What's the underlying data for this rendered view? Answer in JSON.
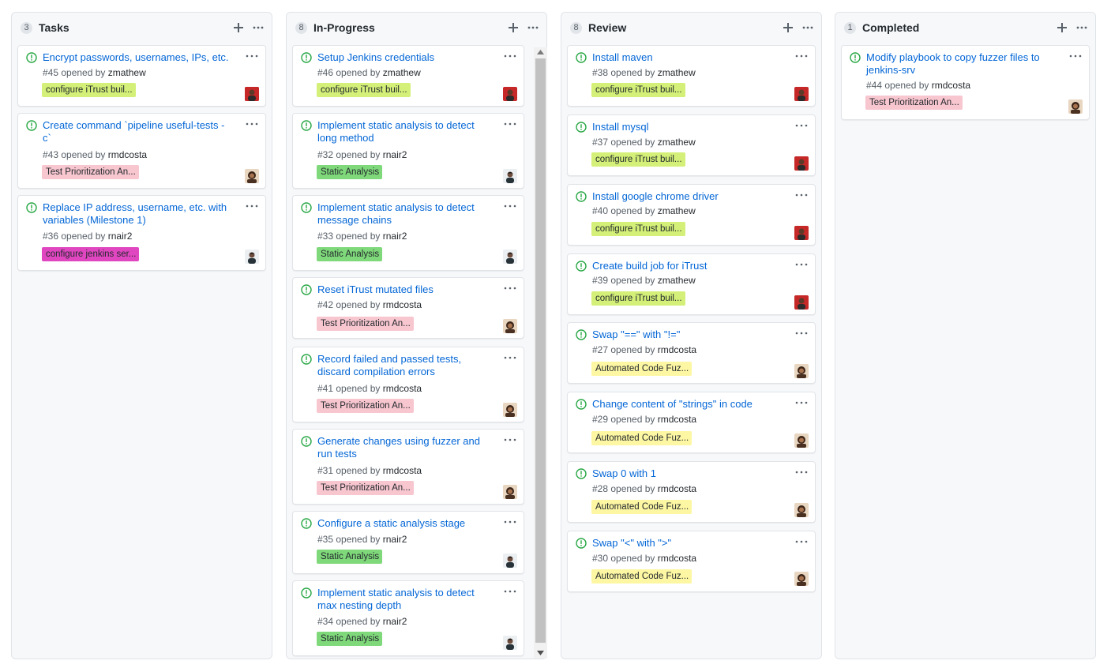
{
  "colors": {
    "configure_itrust": "#d4f078",
    "test_prioritization": "#f7c6cf",
    "static_analysis": "#7fd97a",
    "configure_jenkins": "#e046c0",
    "automated_fuzzer": "#fdf7a3",
    "issue_open": "#28a745",
    "link": "#0366d6"
  },
  "icons": {
    "issue": "issue-opened-icon",
    "plus": "plus-icon",
    "menu": "kebab-horizontal-icon"
  },
  "columns": [
    {
      "count": "3",
      "title": "Tasks",
      "cards": [
        {
          "title": "Encrypt passwords, usernames, IPs, etc.",
          "meta_prefix": "#45 opened by ",
          "user": "zmathew",
          "label": "configure iTrust buil..."
        },
        {
          "title": "Create command `pipeline useful-tests -c`",
          "meta_prefix": "#43 opened by ",
          "user": "rmdcosta",
          "label": "Test Prioritization An..."
        },
        {
          "title": "Replace IP address, username, etc. with variables (Milestone 1)",
          "meta_prefix": "#36 opened by ",
          "user": "rnair2",
          "label": "configure jenkins ser..."
        }
      ]
    },
    {
      "count": "8",
      "title": "In-Progress",
      "cards": [
        {
          "title": "Setup Jenkins credentials",
          "meta_prefix": "#46 opened by ",
          "user": "zmathew",
          "label": "configure iTrust buil..."
        },
        {
          "title": "Implement static analysis to detect long method",
          "meta_prefix": "#32 opened by ",
          "user": "rnair2",
          "label": "Static Analysis"
        },
        {
          "title": "Implement static analysis to detect message chains",
          "meta_prefix": "#33 opened by ",
          "user": "rnair2",
          "label": "Static Analysis"
        },
        {
          "title": "Reset iTrust mutated files",
          "meta_prefix": "#42 opened by ",
          "user": "rmdcosta",
          "label": "Test Prioritization An..."
        },
        {
          "title": "Record failed and passed tests, discard compilation errors",
          "meta_prefix": "#41 opened by ",
          "user": "rmdcosta",
          "label": "Test Prioritization An..."
        },
        {
          "title": "Generate changes using fuzzer and run tests",
          "meta_prefix": "#31 opened by ",
          "user": "rmdcosta",
          "label": "Test Prioritization An..."
        },
        {
          "title": "Configure a static analysis stage",
          "meta_prefix": "#35 opened by ",
          "user": "rnair2",
          "label": "Static Analysis"
        },
        {
          "title": "Implement static analysis to detect max nesting depth",
          "meta_prefix": "#34 opened by ",
          "user": "rnair2",
          "label": "Static Analysis"
        }
      ]
    },
    {
      "count": "8",
      "title": "Review",
      "cards": [
        {
          "title": "Install maven",
          "meta_prefix": "#38 opened by ",
          "user": "zmathew",
          "label": "configure iTrust buil..."
        },
        {
          "title": "Install mysql",
          "meta_prefix": "#37 opened by ",
          "user": "zmathew",
          "label": "configure iTrust buil..."
        },
        {
          "title": "Install google chrome driver",
          "meta_prefix": "#40 opened by ",
          "user": "zmathew",
          "label": "configure iTrust buil..."
        },
        {
          "title": "Create build job for iTrust",
          "meta_prefix": "#39 opened by ",
          "user": "zmathew",
          "label": "configure iTrust buil..."
        },
        {
          "title": "Swap \"==\" with \"!=\"",
          "meta_prefix": "#27 opened by ",
          "user": "rmdcosta",
          "label": "Automated Code Fuz..."
        },
        {
          "title": "Change content of \"strings\" in code",
          "meta_prefix": "#29 opened by ",
          "user": "rmdcosta",
          "label": "Automated Code Fuz..."
        },
        {
          "title": "Swap 0 with 1",
          "meta_prefix": "#28 opened by ",
          "user": "rmdcosta",
          "label": "Automated Code Fuz..."
        },
        {
          "title": "Swap \"<\" with \">\"",
          "meta_prefix": "#30 opened by ",
          "user": "rmdcosta",
          "label": "Automated Code Fuz..."
        }
      ]
    },
    {
      "count": "1",
      "title": "Completed",
      "cards": [
        {
          "title": "Modify playbook to copy fuzzer files to jenkins-srv",
          "meta_prefix": "#44 opened by ",
          "user": "rmdcosta",
          "label": "Test Prioritization An..."
        }
      ]
    }
  ]
}
